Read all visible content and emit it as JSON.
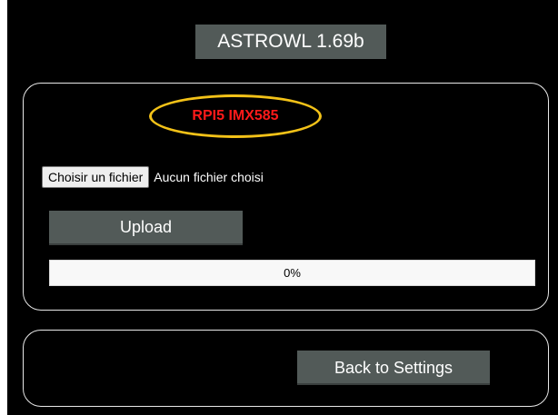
{
  "app": {
    "title": "ASTROWL 1.69b"
  },
  "upload_panel": {
    "model_label": "RPI5 IMX585",
    "file_input": {
      "button_label": "Choisir un fichier",
      "status": "Aucun fichier choisi"
    },
    "upload_label": "Upload",
    "progress": {
      "percent": 0,
      "text": "0%"
    }
  },
  "back_panel": {
    "back_label": "Back to Settings"
  },
  "colors": {
    "background": "#000000",
    "button": "#525a58",
    "panel_border": "#e8e8e8",
    "model_text": "#ff1a1a",
    "model_ring": "#f3c218"
  }
}
